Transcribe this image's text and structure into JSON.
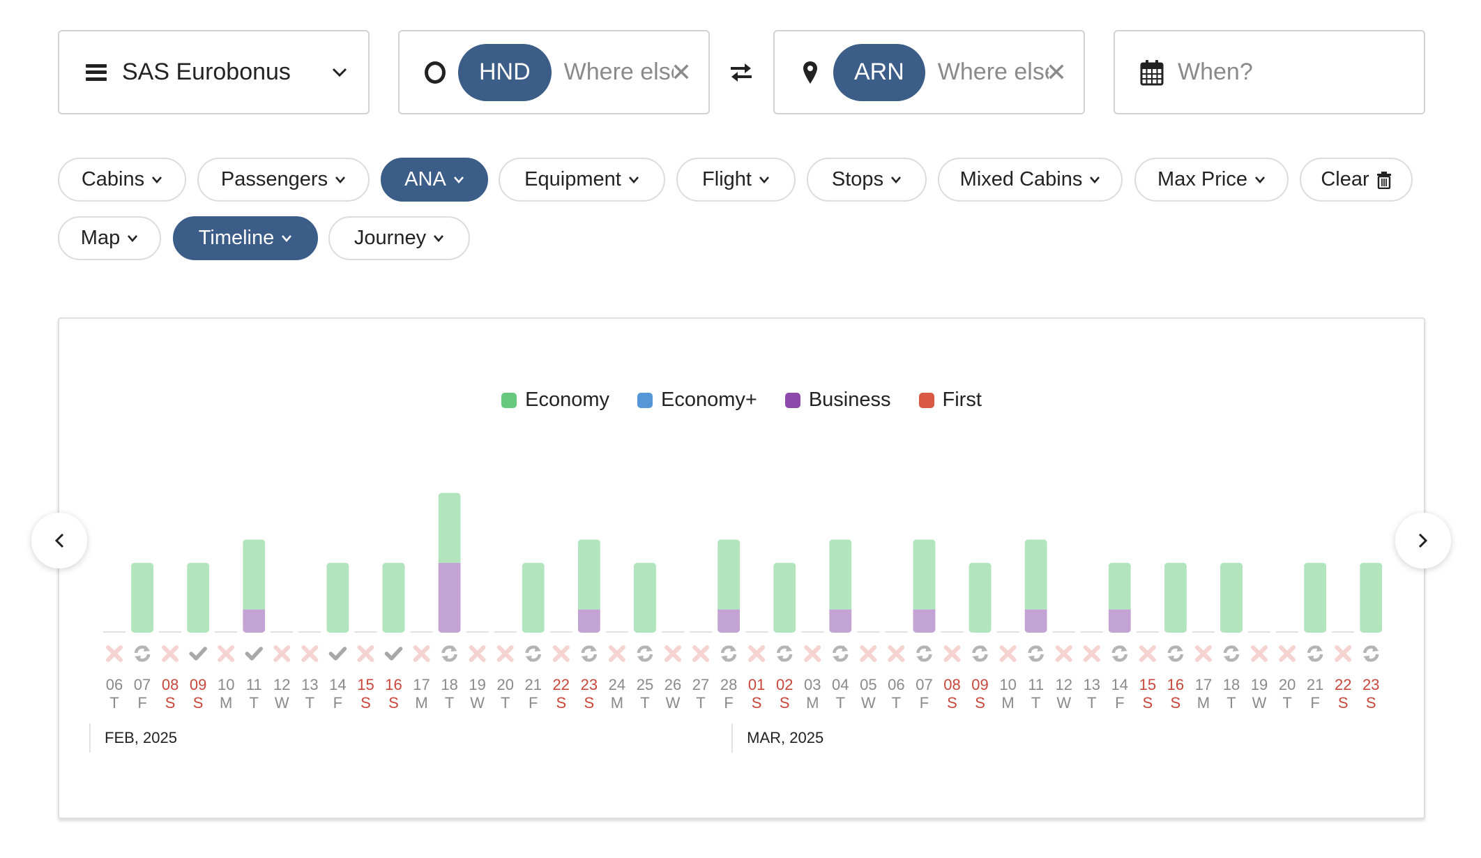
{
  "search": {
    "program": {
      "label": "SAS Eurobonus",
      "icon": "menu-icon"
    },
    "origin": {
      "code": "HND",
      "placeholder": "Where else?",
      "icon": "origin-ring-icon"
    },
    "swap_icon": "swap-arrows-icon",
    "destination": {
      "code": "ARN",
      "placeholder": "Where else?",
      "icon": "map-pin-icon"
    },
    "when": {
      "placeholder": "When?",
      "icon": "calendar-icon"
    }
  },
  "filters": {
    "row1": [
      {
        "label": "Cabins",
        "active": false
      },
      {
        "label": "Passengers",
        "active": false
      },
      {
        "label": "ANA",
        "active": true
      },
      {
        "label": "Equipment",
        "active": false
      },
      {
        "label": "Flight",
        "active": false
      },
      {
        "label": "Stops",
        "active": false
      },
      {
        "label": "Mixed Cabins",
        "active": false
      },
      {
        "label": "Max Price",
        "active": false
      }
    ],
    "clear_label": "Clear",
    "row2": [
      {
        "label": "Map",
        "active": false
      },
      {
        "label": "Timeline",
        "active": true
      },
      {
        "label": "Journey",
        "active": false
      }
    ]
  },
  "colors": {
    "accent": "#3b5d88",
    "economy": "#66c97d",
    "economy_plus": "#5596d8",
    "business": "#8e4aab",
    "first": "#d85a45",
    "economy_bar": "#b2e5bd",
    "business_bar": "#c3a3d3",
    "weekend_text": "#c8473a",
    "weekday_text": "#8a8a8a"
  },
  "chart_data": {
    "type": "bar",
    "stacked": true,
    "title": "",
    "legend": [
      "Economy",
      "Economy+",
      "Business",
      "First"
    ],
    "legend_position": "top-center",
    "months": [
      {
        "label": "FEB, 2025",
        "start_index": 0
      },
      {
        "label": "MAR, 2025",
        "start_index": 23
      }
    ],
    "days": [
      {
        "day": "06",
        "wd": "T",
        "weekend": false,
        "status": "none"
      },
      {
        "day": "07",
        "wd": "F",
        "weekend": false,
        "status": "sync"
      },
      {
        "day": "08",
        "wd": "S",
        "weekend": true,
        "status": "none"
      },
      {
        "day": "09",
        "wd": "S",
        "weekend": true,
        "status": "check"
      },
      {
        "day": "10",
        "wd": "M",
        "weekend": false,
        "status": "none"
      },
      {
        "day": "11",
        "wd": "T",
        "weekend": false,
        "status": "check"
      },
      {
        "day": "12",
        "wd": "W",
        "weekend": false,
        "status": "none"
      },
      {
        "day": "13",
        "wd": "T",
        "weekend": false,
        "status": "none"
      },
      {
        "day": "14",
        "wd": "F",
        "weekend": false,
        "status": "check"
      },
      {
        "day": "15",
        "wd": "S",
        "weekend": true,
        "status": "none"
      },
      {
        "day": "16",
        "wd": "S",
        "weekend": true,
        "status": "check"
      },
      {
        "day": "17",
        "wd": "M",
        "weekend": false,
        "status": "none"
      },
      {
        "day": "18",
        "wd": "T",
        "weekend": false,
        "status": "sync"
      },
      {
        "day": "19",
        "wd": "W",
        "weekend": false,
        "status": "none"
      },
      {
        "day": "20",
        "wd": "T",
        "weekend": false,
        "status": "none"
      },
      {
        "day": "21",
        "wd": "F",
        "weekend": false,
        "status": "sync"
      },
      {
        "day": "22",
        "wd": "S",
        "weekend": true,
        "status": "none"
      },
      {
        "day": "23",
        "wd": "S",
        "weekend": true,
        "status": "sync"
      },
      {
        "day": "24",
        "wd": "M",
        "weekend": false,
        "status": "none"
      },
      {
        "day": "25",
        "wd": "T",
        "weekend": false,
        "status": "sync"
      },
      {
        "day": "26",
        "wd": "W",
        "weekend": false,
        "status": "none"
      },
      {
        "day": "27",
        "wd": "T",
        "weekend": false,
        "status": "none"
      },
      {
        "day": "28",
        "wd": "F",
        "weekend": false,
        "status": "sync"
      },
      {
        "day": "01",
        "wd": "S",
        "weekend": true,
        "status": "none"
      },
      {
        "day": "02",
        "wd": "S",
        "weekend": true,
        "status": "sync"
      },
      {
        "day": "03",
        "wd": "M",
        "weekend": false,
        "status": "none"
      },
      {
        "day": "04",
        "wd": "T",
        "weekend": false,
        "status": "sync"
      },
      {
        "day": "05",
        "wd": "W",
        "weekend": false,
        "status": "none"
      },
      {
        "day": "06",
        "wd": "T",
        "weekend": false,
        "status": "none"
      },
      {
        "day": "07",
        "wd": "F",
        "weekend": false,
        "status": "sync"
      },
      {
        "day": "08",
        "wd": "S",
        "weekend": true,
        "status": "none"
      },
      {
        "day": "09",
        "wd": "S",
        "weekend": true,
        "status": "sync"
      },
      {
        "day": "10",
        "wd": "M",
        "weekend": false,
        "status": "none"
      },
      {
        "day": "11",
        "wd": "T",
        "weekend": false,
        "status": "sync"
      },
      {
        "day": "12",
        "wd": "W",
        "weekend": false,
        "status": "none"
      },
      {
        "day": "13",
        "wd": "T",
        "weekend": false,
        "status": "none"
      },
      {
        "day": "14",
        "wd": "F",
        "weekend": false,
        "status": "sync"
      },
      {
        "day": "15",
        "wd": "S",
        "weekend": true,
        "status": "none"
      },
      {
        "day": "16",
        "wd": "S",
        "weekend": true,
        "status": "sync"
      },
      {
        "day": "17",
        "wd": "M",
        "weekend": false,
        "status": "none"
      },
      {
        "day": "18",
        "wd": "T",
        "weekend": false,
        "status": "sync"
      },
      {
        "day": "19",
        "wd": "W",
        "weekend": false,
        "status": "none"
      },
      {
        "day": "20",
        "wd": "T",
        "weekend": false,
        "status": "none"
      },
      {
        "day": "21",
        "wd": "F",
        "weekend": false,
        "status": "sync"
      },
      {
        "day": "22",
        "wd": "S",
        "weekend": true,
        "status": "none"
      },
      {
        "day": "23",
        "wd": "S",
        "weekend": true,
        "status": "sync"
      }
    ],
    "series": [
      {
        "name": "Economy",
        "values": [
          0,
          3,
          0,
          3,
          0,
          3,
          0,
          0,
          3,
          0,
          3,
          0,
          3,
          0,
          0,
          3,
          0,
          3,
          0,
          3,
          0,
          0,
          3,
          0,
          3,
          0,
          3,
          0,
          0,
          3,
          0,
          3,
          0,
          3,
          0,
          0,
          2,
          0,
          3,
          0,
          3,
          0,
          0,
          3,
          0,
          3
        ]
      },
      {
        "name": "Economy+",
        "values": [
          0,
          0,
          0,
          0,
          0,
          0,
          0,
          0,
          0,
          0,
          0,
          0,
          0,
          0,
          0,
          0,
          0,
          0,
          0,
          0,
          0,
          0,
          0,
          0,
          0,
          0,
          0,
          0,
          0,
          0,
          0,
          0,
          0,
          0,
          0,
          0,
          0,
          0,
          0,
          0,
          0,
          0,
          0,
          0,
          0,
          0
        ]
      },
      {
        "name": "Business",
        "values": [
          0,
          0,
          0,
          0,
          0,
          1,
          0,
          0,
          0,
          0,
          0,
          0,
          3,
          0,
          0,
          0,
          0,
          1,
          0,
          0,
          0,
          0,
          1,
          0,
          0,
          0,
          1,
          0,
          0,
          1,
          0,
          0,
          0,
          1,
          0,
          0,
          1,
          0,
          0,
          0,
          0,
          0,
          0,
          0,
          0,
          0
        ]
      },
      {
        "name": "First",
        "values": [
          0,
          0,
          0,
          0,
          0,
          0,
          0,
          0,
          0,
          0,
          0,
          0,
          0,
          0,
          0,
          0,
          0,
          0,
          0,
          0,
          0,
          0,
          0,
          0,
          0,
          0,
          0,
          0,
          0,
          0,
          0,
          0,
          0,
          0,
          0,
          0,
          0,
          0,
          0,
          0,
          0,
          0,
          0,
          0,
          0,
          0
        ]
      }
    ],
    "ylim": [
      0,
      6
    ]
  }
}
